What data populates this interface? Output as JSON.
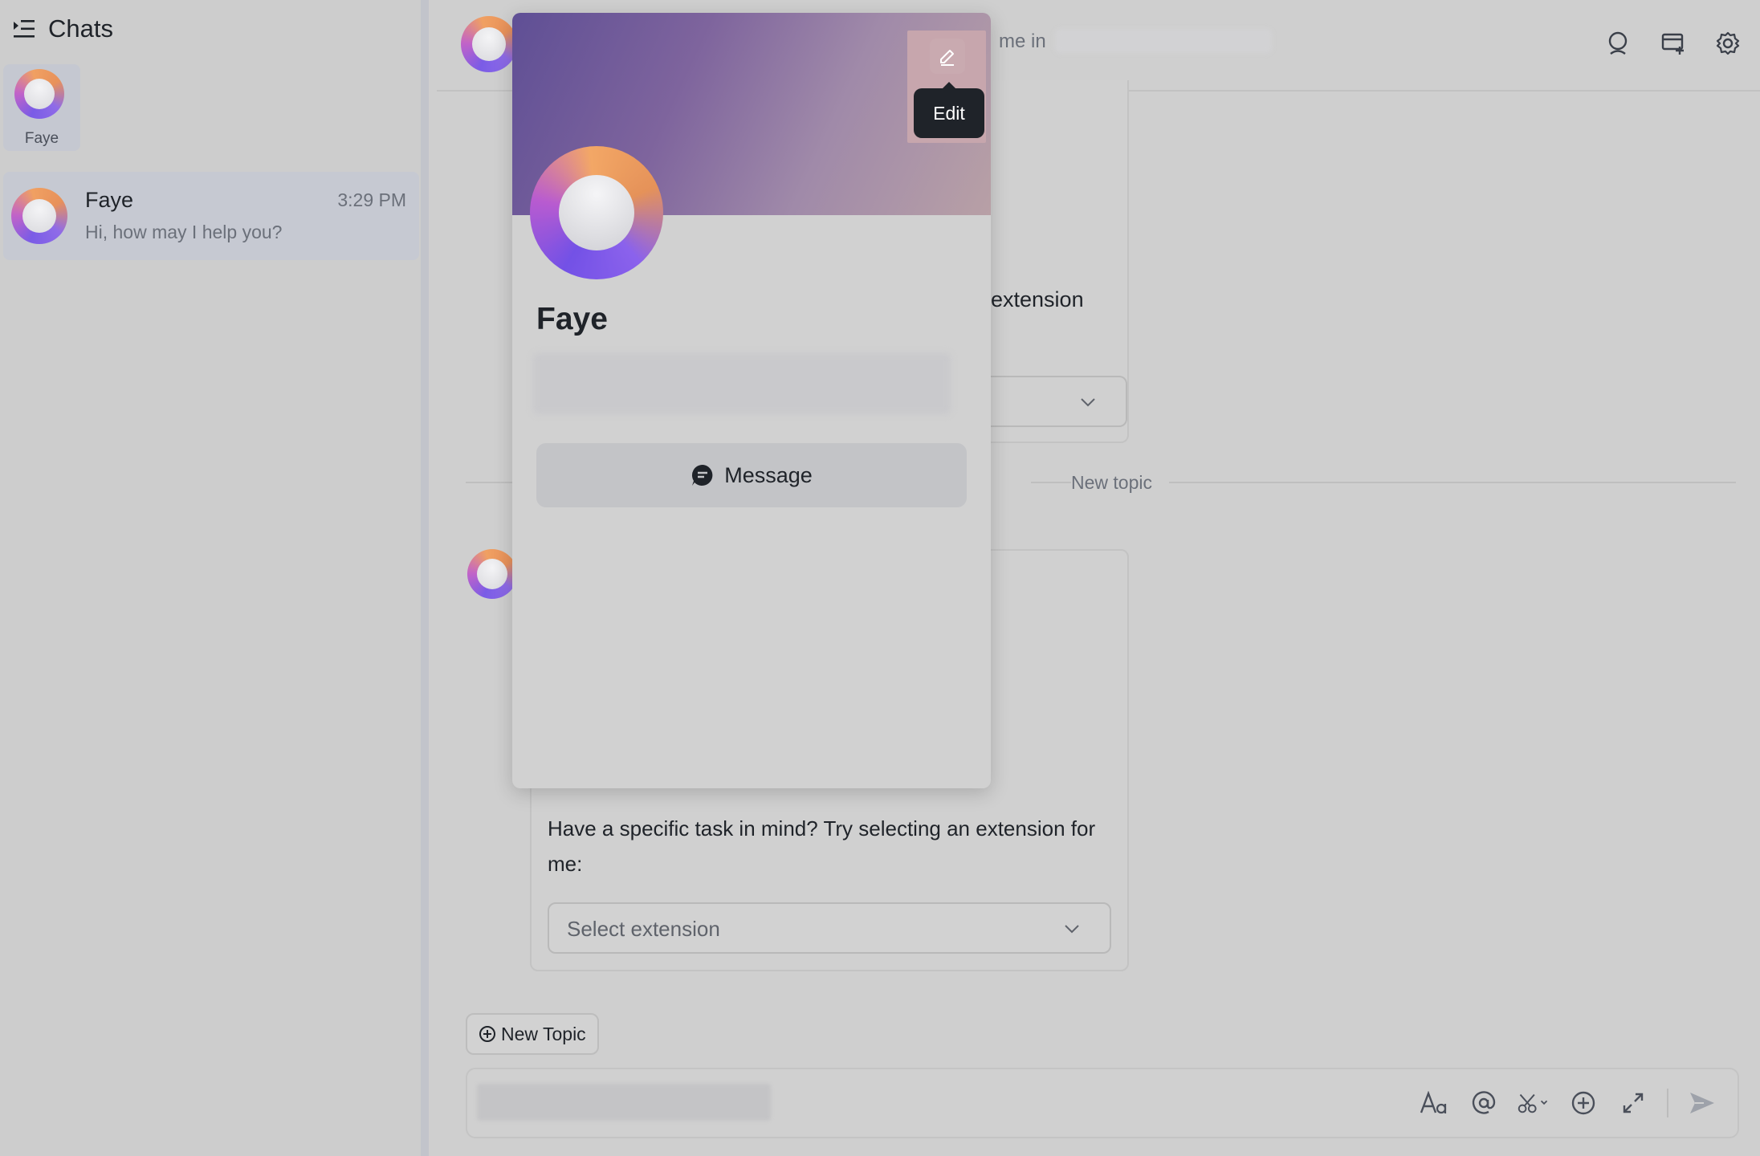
{
  "sidebar": {
    "title": "Chats",
    "pinned": {
      "label": "Faye"
    },
    "chats": [
      {
        "name": "Faye",
        "time": "3:29 PM",
        "preview": "Hi, how may I help you?"
      }
    ]
  },
  "header": {
    "subtitle_fragment": "me in"
  },
  "conversation": {
    "card_fragment_text": "extension",
    "divider_label": "New topic",
    "question": "Have a specific task in mind? Try selecting an extension for me:",
    "select_placeholder": "Select extension",
    "new_topic_label": "New Topic"
  },
  "profile_popup": {
    "name": "Faye",
    "message_label": "Message",
    "edit_tooltip": "Edit"
  },
  "icons": {
    "menu": "sidebar-toggle-icon",
    "search": "search-icon",
    "new_chat": "new-chat-icon",
    "settings": "gear-icon",
    "edit": "pencil-icon",
    "message": "chat-bubble-icon",
    "font": "text-format-icon",
    "mention": "at-sign-icon",
    "scissors": "scissors-icon",
    "add": "plus-circle-icon",
    "expand": "expand-icon",
    "send": "send-icon"
  },
  "colors": {
    "overlay_bg": "#cfcfcf",
    "selected_item": "#c6c9d2",
    "banner_start": "#5f4f95",
    "banner_end": "#b8a0a6",
    "tooltip_bg": "#1f2329"
  }
}
